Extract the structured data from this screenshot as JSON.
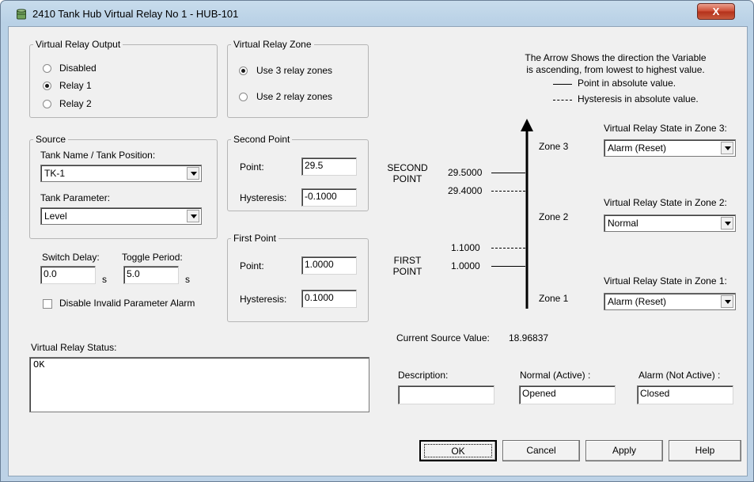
{
  "window": {
    "title": "2410 Tank Hub Virtual Relay No 1 - HUB-101",
    "close_glyph": "X"
  },
  "relay_output": {
    "legend": "Virtual Relay Output",
    "options": [
      "Disabled",
      "Relay 1",
      "Relay 2"
    ],
    "selected": "Relay 1"
  },
  "relay_zone": {
    "legend": "Virtual Relay Zone",
    "options": [
      "Use 3 relay zones",
      "Use 2 relay zones"
    ],
    "selected": "Use 3 relay zones"
  },
  "source": {
    "legend": "Source",
    "tank_label": "Tank Name / Tank Position:",
    "tank_value": "TK-1",
    "param_label": "Tank Parameter:",
    "param_value": "Level"
  },
  "second_point": {
    "legend": "Second Point",
    "point_label": "Point:",
    "point_value": "29.5",
    "hyst_label": "Hysteresis:",
    "hyst_value": "-0.1000"
  },
  "first_point": {
    "legend": "First Point",
    "point_label": "Point:",
    "point_value": "1.0000",
    "hyst_label": "Hysteresis:",
    "hyst_value": "0.1000"
  },
  "timing": {
    "switch_label": "Switch Delay:",
    "switch_value": "0.0",
    "switch_unit": "s",
    "toggle_label": "Toggle Period:",
    "toggle_value": "5.0",
    "toggle_unit": "s"
  },
  "invalid_alarm": {
    "label": "Disable Invalid Parameter Alarm",
    "checked": false
  },
  "status": {
    "label": "Virtual Relay Status:",
    "value": "OK"
  },
  "diagram": {
    "legend_line1": "The Arrow Shows the direction the Variable",
    "legend_line2": "is ascending, from lowest to highest value.",
    "legend_solid": "Point in absolute value.",
    "legend_dashed": "Hysteresis in absolute value.",
    "second_point_title_1": "SECOND",
    "second_point_title_2": "POINT",
    "first_point_title_1": "FIRST",
    "first_point_title_2": "POINT",
    "second_value": "29.5000",
    "second_hyst": "29.4000",
    "first_hyst": "1.1000",
    "first_value": "1.0000",
    "zone3": "Zone 3",
    "zone2": "Zone 2",
    "zone1": "Zone 1"
  },
  "zones": {
    "zone3_label": "Virtual Relay State in Zone 3:",
    "zone3_value": "Alarm (Reset)",
    "zone2_label": "Virtual Relay State in Zone 2:",
    "zone2_value": "Normal",
    "zone1_label": "Virtual Relay State in Zone 1:",
    "zone1_value": "Alarm (Reset)"
  },
  "current": {
    "label": "Current Source Value:",
    "value": "18.96837"
  },
  "description": {
    "desc_label": "Description:",
    "desc_value": "",
    "normal_label": "Normal (Active) :",
    "normal_value": "Opened",
    "alarm_label": "Alarm (Not Active) :",
    "alarm_value": "Closed"
  },
  "buttons": {
    "ok": "OK",
    "cancel": "Cancel",
    "apply": "Apply",
    "help": "Help"
  }
}
